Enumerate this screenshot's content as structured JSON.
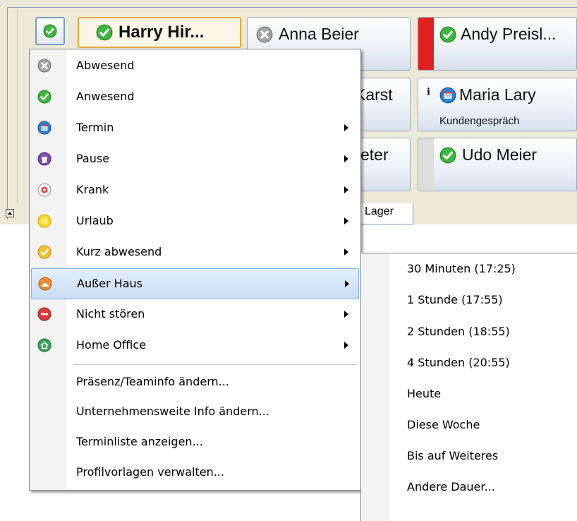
{
  "colors": {
    "hover_bg": "#c9ddf5",
    "busy_red": "#e02121",
    "present_green": "#3fb63f",
    "absent_gray": "#9b9b9b"
  },
  "tiles": {
    "harry": {
      "name": "Harry Hir...",
      "status_icon": "present-check-icon"
    },
    "anna": {
      "name": "Anna Beier",
      "status_icon": "absent-x-icon"
    },
    "andy": {
      "name": "Andy Preisl...",
      "status_icon": "present-check-icon"
    },
    "karst": {
      "name": "Karst"
    },
    "maria": {
      "name": "Maria Lary",
      "info": "i",
      "sub": "Kundengespräch",
      "status_icon": "appointment-calendar-icon"
    },
    "peter": {
      "name": "eter"
    },
    "udo": {
      "name": "Udo Meier",
      "status_icon": "present-check-icon"
    }
  },
  "tabs": {
    "lager": "Lager"
  },
  "menu": {
    "items": [
      {
        "label": "Abwesend",
        "icon": "absent-x-icon"
      },
      {
        "label": "Anwesend",
        "icon": "present-check-icon"
      },
      {
        "label": "Termin",
        "icon": "appointment-calendar-icon"
      },
      {
        "label": "Pause",
        "icon": "pause-cup-icon"
      },
      {
        "label": "Krank",
        "icon": "sick-cross-icon"
      },
      {
        "label": "Urlaub",
        "icon": "vacation-sun-icon"
      },
      {
        "label": "Kurz abwesend",
        "icon": "short-absence-check-icon"
      },
      {
        "label": "Außer Haus",
        "icon": "out-of-office-car-icon"
      },
      {
        "label": "Nicht stören",
        "icon": "do-not-disturb-icon"
      },
      {
        "label": "Home Office",
        "icon": "home-office-icon"
      }
    ],
    "actions": [
      "Präsenz/Teaminfo ändern...",
      "Unternehmensweite Info ändern...",
      "Terminliste anzeigen...",
      "Profilvorlagen verwalten..."
    ]
  },
  "submenu": {
    "items": [
      "30 Minuten (17:25)",
      "1 Stunde (17:55)",
      "2 Stunden (18:55)",
      "4 Stunden (20:55)",
      "Heute",
      "Diese Woche",
      "Bis auf Weiteres",
      "Andere Dauer..."
    ]
  }
}
